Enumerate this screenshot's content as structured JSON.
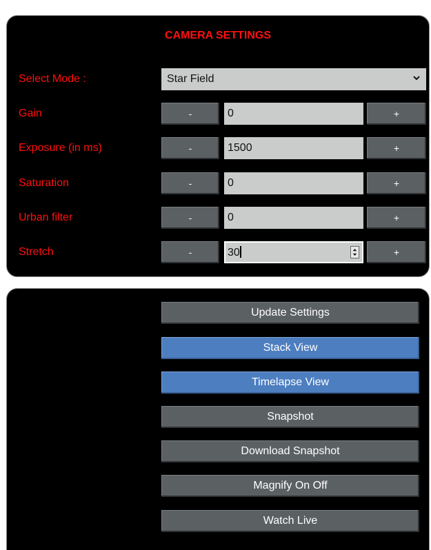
{
  "settings": {
    "title": "CAMERA SETTINGS",
    "mode_label": "Select Mode :",
    "mode_value": "Star Field",
    "rows": [
      {
        "label": "Gain",
        "value": "0",
        "minus": "-",
        "plus": "+"
      },
      {
        "label": "Exposure (in ms)",
        "value": "1500",
        "minus": "-",
        "plus": "+"
      },
      {
        "label": "Saturation",
        "value": "0",
        "minus": "-",
        "plus": "+"
      },
      {
        "label": "Urban filter",
        "value": "0",
        "minus": "-",
        "plus": "+"
      },
      {
        "label": "Stretch",
        "value": "30",
        "minus": "-",
        "plus": "+"
      }
    ]
  },
  "actions": {
    "update_settings": "Update Settings",
    "stack_view": "Stack View",
    "timelapse_view": "Timelapse View",
    "snapshot": "Snapshot",
    "download_snapshot": "Download Snapshot",
    "magnify": "Magnify On Off",
    "watch_live": "Watch Live"
  },
  "colors": {
    "label_red": "#ff1010",
    "panel_bg": "#000000",
    "button_gray": "#5b6063",
    "button_blue": "#4d7ec0",
    "input_bg": "#c9cccb"
  }
}
